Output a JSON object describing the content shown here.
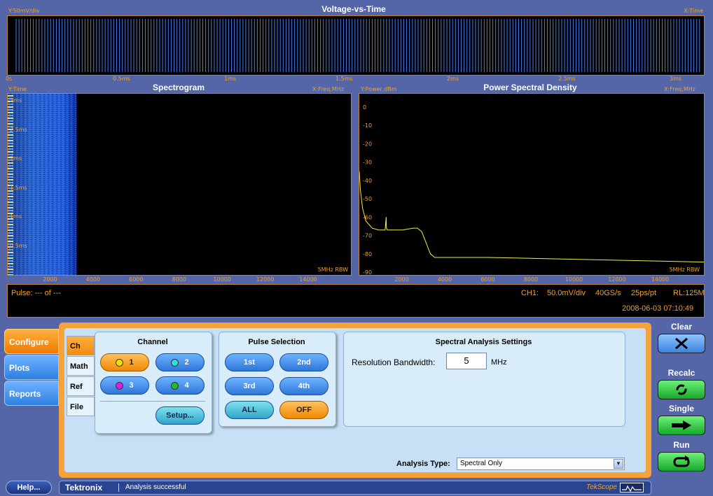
{
  "vt": {
    "title": "Voltage-vs-Time",
    "y_axis": "Y:50mV/div",
    "x_axis": "X:Time",
    "x_ticks": [
      "0s",
      "0.5ms",
      "1ms",
      "1.5ms",
      "2ms",
      "2.5ms",
      "3ms"
    ]
  },
  "spectrogram": {
    "title": "Spectrogram",
    "y_axis": "Y:Time",
    "x_axis": "X:Freq,MHz",
    "y_ticks": [
      "3ms",
      "2.5ms",
      "2ms",
      "1.5ms",
      "1ms",
      "0.5ms"
    ],
    "x_ticks": [
      "2000",
      "4000",
      "6000",
      "8000",
      "10000",
      "12000",
      "14000"
    ],
    "rbw": "5MHz RBW"
  },
  "psd": {
    "title": "Power Spectral Density",
    "y_axis": "Y:Power,dBm",
    "x_axis": "X:Freq,MHz",
    "y_ticks": [
      "0",
      "-10",
      "-20",
      "-30",
      "-40",
      "-50",
      "-60",
      "-70",
      "-80",
      "-90"
    ],
    "x_ticks": [
      "2000",
      "4000",
      "6000",
      "8000",
      "10000",
      "12000",
      "14000"
    ],
    "rbw": "5MHz RBW"
  },
  "status": {
    "pulse": "Pulse: --- of ---",
    "ch1_label": "CH1:",
    "ch1_scale": "50.0mV/div",
    "sample_rate": "40GS/s",
    "ps_pt": "25ps/pt",
    "record_length": "RL:125M",
    "timestamp": "2008-06-03 07:10:49"
  },
  "nav": {
    "configure": "Configure",
    "plots": "Plots",
    "reports": "Reports"
  },
  "subtabs": [
    "Ch",
    "Math",
    "Ref",
    "File"
  ],
  "channel": {
    "title": "Channel",
    "ch1": "1",
    "ch2": "2",
    "ch3": "3",
    "ch4": "4",
    "setup": "Setup...",
    "colors": {
      "ch1": "#f0e000",
      "ch2": "#30e0e0",
      "ch3": "#e020e0",
      "ch4": "#20c020"
    }
  },
  "pulse_selection": {
    "title": "Pulse Selection",
    "first": "1st",
    "second": "2nd",
    "third": "3rd",
    "fourth": "4th",
    "all": "ALL",
    "off": "OFF"
  },
  "spectral": {
    "title": "Spectral Analysis Settings",
    "rbw_label": "Resolution Bandwidth:",
    "rbw_value": "5",
    "rbw_unit": "MHz"
  },
  "analysis": {
    "label": "Analysis Type:",
    "value": "Spectral Only"
  },
  "controls": {
    "clear": "Clear",
    "recalc": "Recalc",
    "single": "Single",
    "run": "Run"
  },
  "footer": {
    "help": "Help...",
    "brand": "Tektronix",
    "message": "Analysis successful",
    "app": "TekScope"
  },
  "chart_data": [
    {
      "type": "line",
      "title": "Voltage-vs-Time",
      "xlabel": "X:Time",
      "ylabel": "Y:50mV/div",
      "x_ticks": [
        "0s",
        "0.5ms",
        "1ms",
        "1.5ms",
        "2ms",
        "2.5ms",
        "3ms"
      ]
    },
    {
      "type": "heatmap",
      "title": "Spectrogram",
      "xlabel": "X:Freq,MHz",
      "ylabel": "Y:Time",
      "x_ticks": [
        2000,
        4000,
        6000,
        8000,
        10000,
        12000,
        14000
      ],
      "y_ticks": [
        "3ms",
        "2.5ms",
        "2ms",
        "1.5ms",
        "1ms",
        "0.5ms"
      ],
      "xlim": [
        0,
        16000
      ],
      "note_band_mhz": [
        0,
        3200
      ]
    },
    {
      "type": "line",
      "title": "Power Spectral Density",
      "xlabel": "X:Freq,MHz",
      "ylabel": "Y:Power,dBm",
      "xlim": [
        0,
        16000
      ],
      "ylim": [
        -90,
        0
      ],
      "series": [
        {
          "x": [
            0,
            50,
            150,
            300,
            600,
            900,
            1200,
            1250,
            1260,
            1300,
            1500,
            2000,
            2500,
            2700,
            2900,
            3100,
            3300,
            3500,
            4000,
            6000,
            8000,
            10000,
            12000,
            14000,
            16000
          ],
          "y": [
            -35,
            -45,
            -55,
            -62,
            -66,
            -67,
            -67,
            -60,
            -66,
            -67,
            -67,
            -67,
            -66,
            -66,
            -68,
            -74,
            -80,
            -82,
            -82,
            -82,
            -82.5,
            -83,
            -83.5,
            -84,
            -84.5
          ]
        }
      ]
    }
  ]
}
